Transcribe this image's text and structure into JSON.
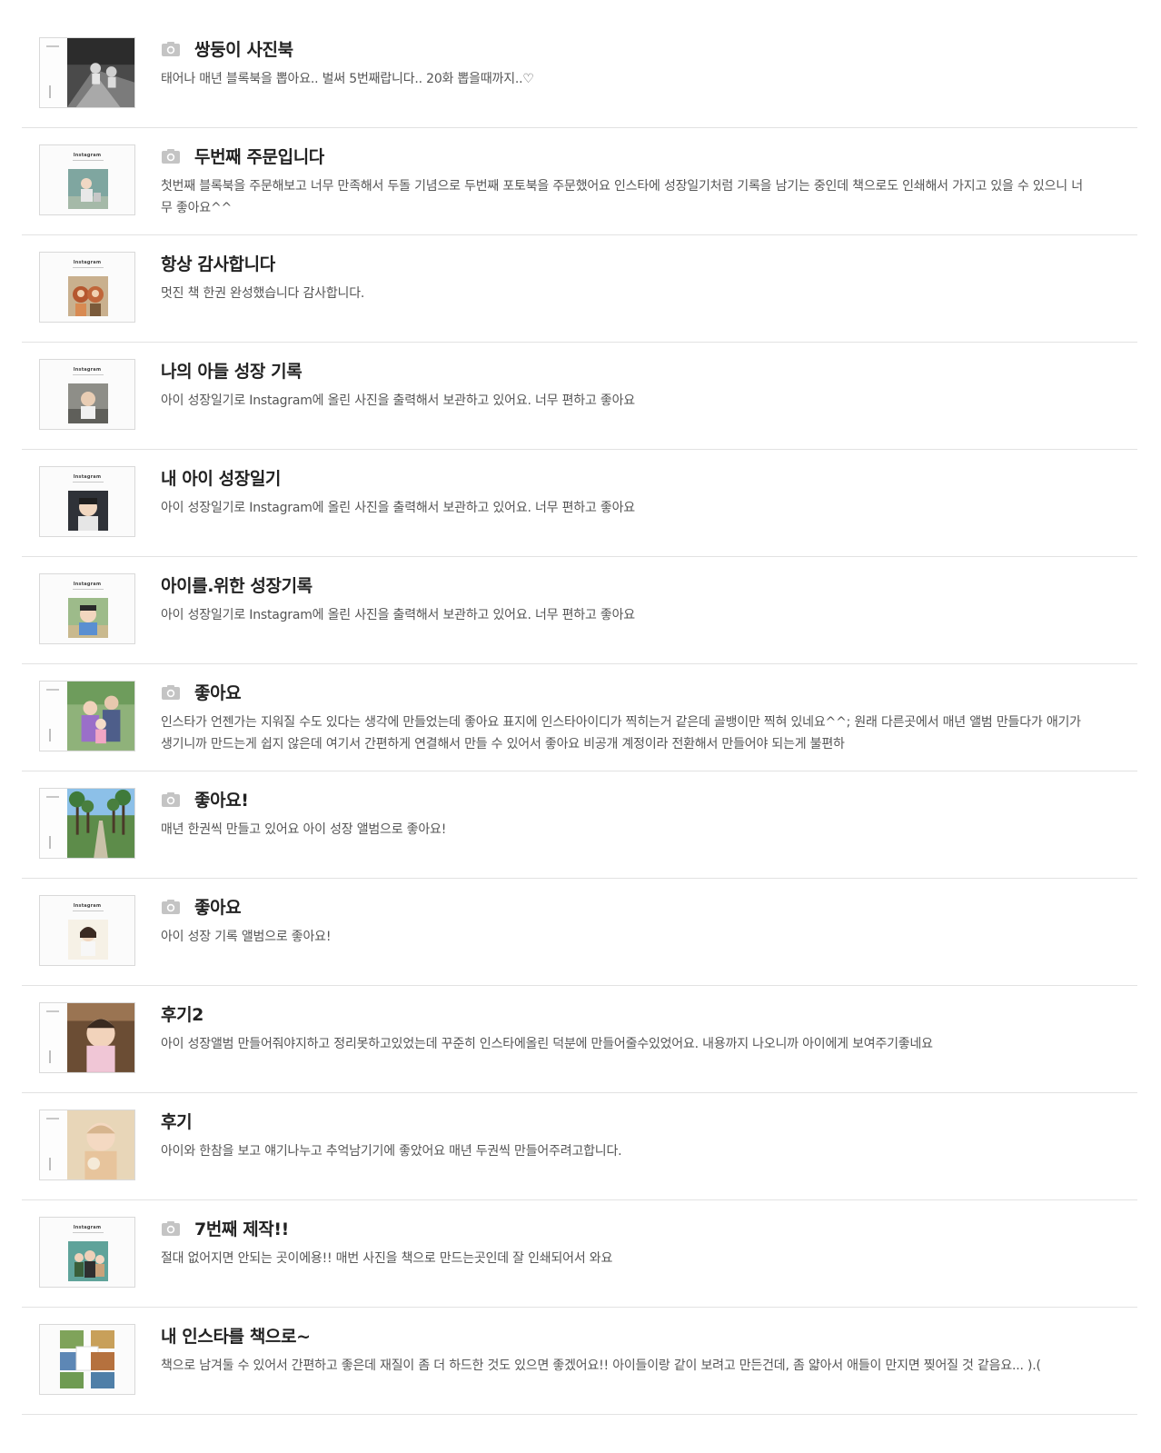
{
  "reviews": [
    {
      "title": "쌍둥이 사진북",
      "has_photo": true,
      "thumb_icon": "twin-baby-photo",
      "text": "태어나 매년 블록북을 뽑아요.. 벌써 5번째랍니다.. 20화 뽑을때까지..♡"
    },
    {
      "title": "두번째 주문입니다",
      "has_photo": true,
      "thumb_icon": "instagram-book-cover",
      "text": "첫번째 블록북을 주문해보고 너무 만족해서 두돌 기념으로 두번째 포토북을 주문했어요 인스타에 성장일기처럼 기록을 남기는 중인데 책으로도 인쇄해서 가지고 있을 수 있으니 너무 좋아요^^"
    },
    {
      "title": "항상 감사합니다",
      "has_photo": false,
      "thumb_icon": "instagram-book-cover",
      "text": "멋진 책 한권 완성했습니다 감사합니다."
    },
    {
      "title": "나의 아들 성장 기록",
      "has_photo": false,
      "thumb_icon": "instagram-book-cover",
      "text": "아이 성장일기로 Instagram에 올린 사진을 출력해서 보관하고 있어요. 너무 편하고 좋아요"
    },
    {
      "title": "내 아이 성장일기",
      "has_photo": false,
      "thumb_icon": "instagram-book-cover",
      "text": "아이 성장일기로 Instagram에 올린 사진을 출력해서 보관하고 있어요. 너무 편하고 좋아요"
    },
    {
      "title": "아이를.위한 성장기록",
      "has_photo": false,
      "thumb_icon": "instagram-book-cover",
      "text": "아이 성장일기로 Instagram에 올린 사진을 출력해서 보관하고 있어요. 너무 편하고 좋아요"
    },
    {
      "title": "좋아요",
      "has_photo": true,
      "thumb_icon": "family-photo",
      "text": "인스타가 언젠가는 지워질 수도 있다는 생각에 만들었는데 좋아요 표지에 인스타아이디가 찍히는거 같은데 골뱅이만 찍혀 있네요^^; 원래 다른곳에서 매년 앨범 만들다가 애기가 생기니까 만드는게 쉽지 않은데 여기서 간편하게 연결해서 만들 수 있어서 좋아요 비공개 계정이라 전환해서 만들어야 되는게 불편하"
    },
    {
      "title": "좋아요!",
      "has_photo": true,
      "thumb_icon": "palm-road-photo",
      "text": "매년 한권씩 만들고 있어요 아이 성장 앨범으로 좋아요!"
    },
    {
      "title": "좋아요",
      "has_photo": true,
      "thumb_icon": "instagram-book-cover",
      "text": "아이 성장 기록 앨범으로 좋아요!"
    },
    {
      "title": "후기2",
      "has_photo": false,
      "thumb_icon": "baby-photo",
      "text": "아이 성장앨범 만들어줘야지하고 정리못하고있었는데 꾸준히 인스타에올린 덕분에 만들어줄수있었어요. 내용까지 나오니까 아이에게 보여주기좋네요"
    },
    {
      "title": "후기",
      "has_photo": false,
      "thumb_icon": "baby-photo",
      "text": "아이와 한참을 보고 얘기나누고 추억남기기에 좋았어요 매년 두권씩 만들어주려고합니다."
    },
    {
      "title": "7번째 제작!!",
      "has_photo": true,
      "thumb_icon": "instagram-book-cover",
      "text": "절대 없어지면 안되는 곳이에용!! 매번 사진을 책으로 만드는곳인데 잘 인쇄되어서 와요"
    },
    {
      "title": "내 인스타를 책으로~",
      "has_photo": false,
      "thumb_icon": "photo-grid-cover",
      "text": "책으로 남겨둘 수 있어서 간편하고 좋은데 재질이 좀 더 하드한 것도 있으면 좋겠어요!! 아이들이랑 같이 보려고 만든건데, 좀 얇아서 애들이 만지면 찢어질 것 같음요... ).("
    }
  ],
  "brand_text": "Instagram",
  "colors": {
    "title": "#222222",
    "body": "#555555",
    "divider": "#e2e2e2",
    "icon": "#c4c4c4"
  }
}
